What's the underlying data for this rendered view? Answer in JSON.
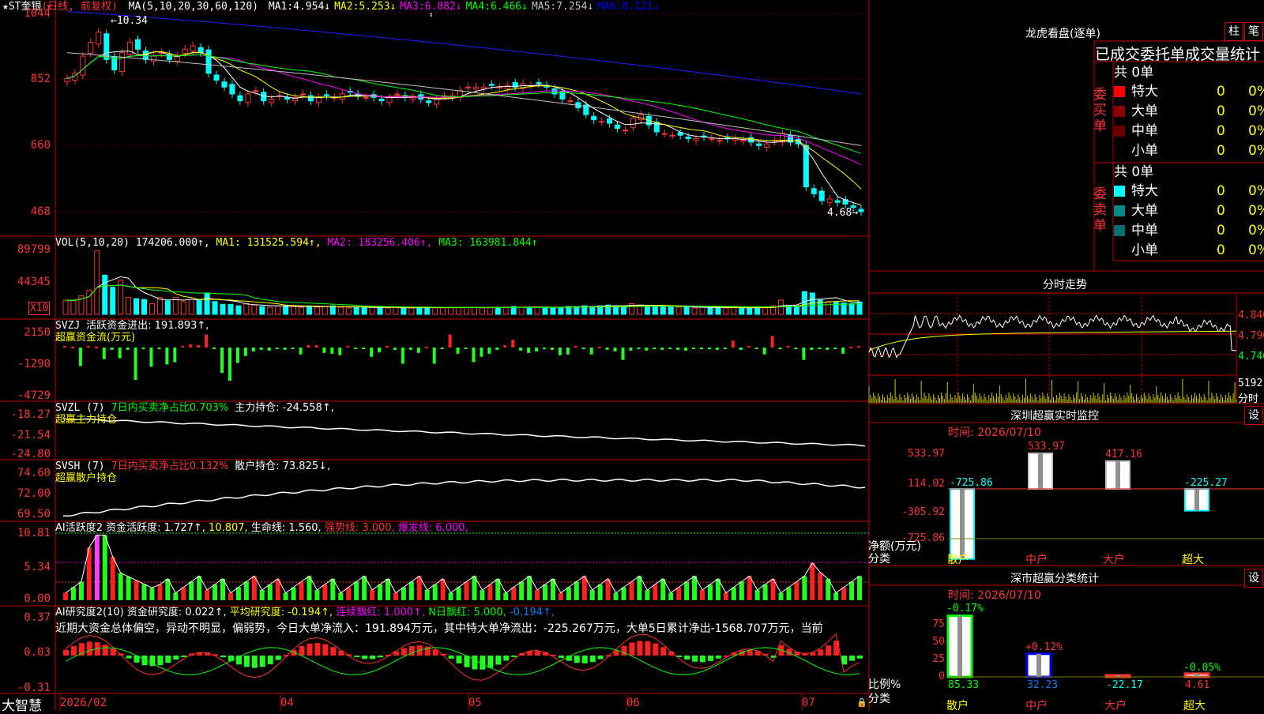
{
  "app_name": "大智慧",
  "stock": {
    "name": "★ST奎银",
    "period": "(日线, 前复权)"
  },
  "price_panel": {
    "ma_label": "MA(5,10,20,30,60,120)",
    "mas": [
      {
        "label": "MA1:",
        "value": "4.954↓",
        "color": "#ffffff"
      },
      {
        "label": "MA2:",
        "value": "5.253↓",
        "color": "#ffff00"
      },
      {
        "label": "MA3:",
        "value": "6.082↓",
        "color": "#ff00ff"
      },
      {
        "label": "MA4:",
        "value": "6.466↓",
        "color": "#00ff00"
      },
      {
        "label": "MA5:",
        "value": "7.254↓",
        "color": "#c0c0c0"
      },
      {
        "label": "MA6:",
        "value": "8.121↓",
        "color": "#0000ff"
      }
    ],
    "axis": [
      "1044",
      "852",
      "660",
      "468"
    ],
    "high_label": "10.34",
    "low_label": "4.68"
  },
  "vol_panel": {
    "label": "VOL(5,10,20)",
    "value": "174206.000↑,",
    "ma1": "MA1: 131525.594↑,",
    "ma2": "MA2: 183256.406↑,",
    "ma3": "MA3: 163981.844↑",
    "axis": [
      "89799",
      "44345"
    ],
    "unit": "X10"
  },
  "svzj_panel": {
    "label": "SVZJ",
    "active": "活跃资金进出: 191.893↑,",
    "sub": "超赢资金流(万元)",
    "axis": [
      "2150",
      "-1290",
      "-4729"
    ]
  },
  "svzl_panel": {
    "label": "SVZL (7)",
    "ratio": "7日内买卖净占比0.703%",
    "main": "主力持仓: -24.558↑,",
    "sub": "超赢主力持仓",
    "axis": [
      "-18.27",
      "-21.54",
      "-24.80"
    ]
  },
  "svsh_panel": {
    "label": "SVSH (7)",
    "ratio": "7日内买卖净占比0.132%",
    "retail": "散户持仓: 73.825↓,",
    "sub": "超赢散户持仓",
    "axis": [
      "74.60",
      "72.00",
      "69.50"
    ]
  },
  "ai_active_panel": {
    "label": "AI活跃度2",
    "active": "资金活跃度: 1.727↑,",
    "v2": "10.807,",
    "life": "生命线: 1.560,",
    "strong": "强势线: 3.000,",
    "burst": "爆发线: 6.000,",
    "axis": [
      "10.81",
      "5.34",
      "0.00"
    ]
  },
  "ai_research_panel": {
    "label": "AI研究度2(10)",
    "research": "资金研究度: 0.022↑,",
    "avg": "平均研究度: -0.194↑,",
    "red": "连续飘红: 1.000↑,",
    "n_red": "N日飘红: 5.000,",
    "last": "-0.194↑,",
    "comment": "近期大资金总体偏空，异动不明显，偏弱势，今日大单净流入：191.894万元，其中特大单净流出：-225.267万元，大单5日累计净出-1568.707万元，当前",
    "axis": [
      "0.37",
      "0.03",
      "-0.31"
    ]
  },
  "date_axis": [
    "2026/02",
    "04",
    "05",
    "06",
    "07"
  ],
  "right": {
    "title": "龙虎看盘(逐单)",
    "btn1": "柱",
    "btn2": "笔",
    "stats_title": "已成交委托单成交量统计",
    "buy": {
      "side": [
        "委",
        "买",
        "单"
      ],
      "total": "共 0单",
      "rows": [
        {
          "name": "特大",
          "v": "0",
          "p": "0%",
          "color": "#ff0000"
        },
        {
          "name": "大单",
          "v": "0",
          "p": "0%",
          "color": "#8b0000"
        },
        {
          "name": "中单",
          "v": "0",
          "p": "0%",
          "color": "#6b0000"
        },
        {
          "name": "小单",
          "v": "0",
          "p": "0%",
          "color": ""
        }
      ]
    },
    "sell": {
      "side": [
        "委",
        "卖",
        "单"
      ],
      "total": "共 0单",
      "rows": [
        {
          "name": "特大",
          "v": "0",
          "p": "0%",
          "color": "#00ffff"
        },
        {
          "name": "大单",
          "v": "0",
          "p": "0%",
          "color": "#008b8b"
        },
        {
          "name": "中单",
          "v": "0",
          "p": "0%",
          "color": "#007070"
        },
        {
          "name": "小单",
          "v": "0",
          "p": "0%",
          "color": ""
        }
      ]
    },
    "intraday": {
      "title": "分时走势",
      "p1": "4.840",
      "p2": "4.790",
      "p3": "4.740",
      "vol": "5192",
      "vol_label": "分时"
    },
    "monitor": {
      "title": "深圳超赢实时监控",
      "btn": "设",
      "date": "时间: 2026/07/10",
      "axis": [
        "533.97",
        "114.02",
        "-305.92",
        "-725.86"
      ],
      "ylabel": "净额(万元)",
      "xlabel": "分类",
      "cats": [
        "散户",
        "中户",
        "大户",
        "超大"
      ],
      "values": [
        -725.86,
        533.97,
        417.16,
        -225.27
      ],
      "labels": [
        "-725.86",
        "533.97",
        "417.16",
        "-225.27"
      ]
    },
    "classify": {
      "title": "深市超赢分类统计",
      "btn": "设",
      "date": "时间: 2026/07/10",
      "axis": [
        "75",
        "50",
        "25",
        "0"
      ],
      "ylabel": "比例%",
      "xlabel": "分类",
      "cats": [
        "散户",
        "中户",
        "大户",
        "超大"
      ],
      "values": [
        85.33,
        32.23,
        -22.17,
        4.61
      ],
      "value_labels": [
        "85.33",
        "32.23",
        "-22.17",
        "4.61"
      ],
      "changes": [
        "-0.17%",
        "+0.12%",
        "",
        "-0.05%"
      ]
    }
  },
  "chart_data": [
    {
      "type": "candlestick",
      "title": "★ST奎银 (日线, 前复权)",
      "x_ticks": [
        "2026/02",
        "04",
        "05",
        "06",
        "07"
      ],
      "ylim": [
        4.3,
        10.5
      ],
      "close": [
        8.55,
        8.7,
        9.2,
        9.6,
        9.9,
        9.1,
        8.8,
        9.3,
        9.6,
        9.4,
        9.1,
        9.2,
        9.3,
        9.1,
        9.2,
        9.4,
        9.5,
        9.3,
        8.7,
        8.5,
        8.3,
        8.1,
        7.9,
        8.1,
        8.2,
        7.9,
        7.95,
        8.05,
        7.95,
        8.0,
        8.1,
        7.9,
        8.0,
        8.05,
        8.0,
        8.1,
        8.15,
        8.05,
        8.0,
        8.0,
        7.9,
        8.0,
        8.1,
        8.0,
        8.0,
        7.95,
        7.85,
        7.95,
        8.05,
        8.05,
        8.2,
        8.3,
        8.3,
        8.3,
        8.35,
        8.3,
        8.35,
        8.3,
        8.4,
        8.35,
        8.4,
        8.3,
        8.1,
        7.95,
        7.9,
        7.7,
        7.5,
        7.35,
        7.3,
        7.25,
        7.1,
        7.05,
        7.4,
        7.5,
        7.2,
        7.0,
        6.95,
        6.9,
        6.9,
        6.8,
        6.8,
        6.85,
        6.8,
        6.75,
        6.8,
        6.8,
        6.75,
        6.7,
        6.6,
        6.65,
        6.75,
        6.95,
        6.7,
        6.65,
        5.4,
        5.2,
        5.0,
        5.05,
        4.95,
        4.9,
        4.8,
        4.68
      ],
      "ma_values_last": {
        "MA1": 4.954,
        "MA2": 5.253,
        "MA3": 6.082,
        "MA4": 6.466,
        "MA5": 7.254,
        "MA6": 8.121
      },
      "annotations": [
        "10.34",
        "4.68"
      ]
    },
    {
      "type": "bar",
      "title": "VOL(5,10,20)",
      "ylim": [
        0,
        89799
      ],
      "values": [
        20000,
        19000,
        26000,
        34000,
        89000,
        55000,
        38000,
        48000,
        24000,
        22000,
        21000,
        15000,
        24000,
        19000,
        24000,
        18000,
        21000,
        20000,
        30000,
        18000,
        14000,
        14000,
        12000,
        15000,
        13000,
        11000,
        10000,
        12000,
        12000,
        11000,
        10000,
        12000,
        10000,
        11000,
        12000,
        10000,
        9000,
        10000,
        10000,
        10000,
        9000,
        9000,
        10000,
        9000,
        9000,
        10000,
        10000,
        9000,
        9000,
        10000,
        10000,
        10000,
        10000,
        9000,
        9000,
        10000,
        10000,
        11000,
        10000,
        10000,
        10000,
        10000,
        10000,
        10000,
        11000,
        11000,
        12000,
        11000,
        12000,
        13000,
        12000,
        12000,
        15000,
        13000,
        12000,
        12000,
        11000,
        11000,
        10000,
        10000,
        9000,
        10000,
        10000,
        9000,
        9000,
        10000,
        9000,
        9000,
        10000,
        9000,
        12000,
        20000,
        12000,
        12000,
        32000,
        30000,
        20000,
        18000,
        17000,
        16000,
        15000,
        17420
      ]
    },
    {
      "type": "bar",
      "title": "超赢资金流(万元)",
      "ylim": [
        -4729,
        2150
      ],
      "values": [
        200,
        100,
        -2400,
        200,
        100,
        -1500,
        -300,
        -1400,
        -300,
        -4200,
        -200,
        -2500,
        -100,
        -2200,
        -1900,
        200,
        400,
        300,
        1700,
        -200,
        -3300,
        -4300,
        -2000,
        -1100,
        -500,
        -300,
        -400,
        -200,
        -300,
        -200,
        -900,
        300,
        300,
        -700,
        -800,
        -1000,
        200,
        -100,
        -200,
        -1200,
        -600,
        200,
        -300,
        -2100,
        -300,
        -700,
        100,
        -2100,
        -200,
        1700,
        -800,
        -200,
        -1900,
        -1200,
        -800,
        -300,
        300,
        1000,
        -400,
        -700,
        -500,
        -200,
        -300,
        -1000,
        -900,
        200,
        -100,
        -900,
        100,
        -300,
        -500,
        -1600,
        -400,
        -200,
        -400,
        -200,
        -300,
        -100,
        -300,
        -400,
        -200,
        -200,
        -100,
        -300,
        -200,
        900,
        -300,
        200,
        -200,
        -900,
        1500,
        -200,
        200,
        -100,
        -1600,
        -300,
        -200,
        -300,
        -200,
        -800,
        100,
        191.893
      ]
    },
    {
      "type": "line",
      "title": "超赢主力持仓",
      "ylim": [
        -24.8,
        -18.27
      ],
      "last": -24.558
    },
    {
      "type": "line",
      "title": "超赢散户持仓",
      "ylim": [
        69.5,
        74.6
      ],
      "last": 73.825
    },
    {
      "type": "bar",
      "title": "AI活跃度2",
      "ylim": [
        0,
        10.81
      ],
      "last": 1.727
    },
    {
      "type": "bar",
      "title": "AI研究度2(10)",
      "ylim": [
        -0.31,
        0.37
      ],
      "last": 0.022
    },
    {
      "type": "bar",
      "title": "深圳超赢实时监控",
      "categories": [
        "散户",
        "中户",
        "大户",
        "超大"
      ],
      "values": [
        -725.86,
        533.97,
        417.16,
        -225.27
      ],
      "ylabel": "净额(万元)",
      "xlabel": "分类"
    },
    {
      "type": "bar",
      "title": "深市超赢分类统计",
      "categories": [
        "散户",
        "中户",
        "大户",
        "超大"
      ],
      "values": [
        85.33,
        32.23,
        -22.17,
        4.61
      ],
      "ylabel": "比例%",
      "xlabel": "分类"
    }
  ]
}
